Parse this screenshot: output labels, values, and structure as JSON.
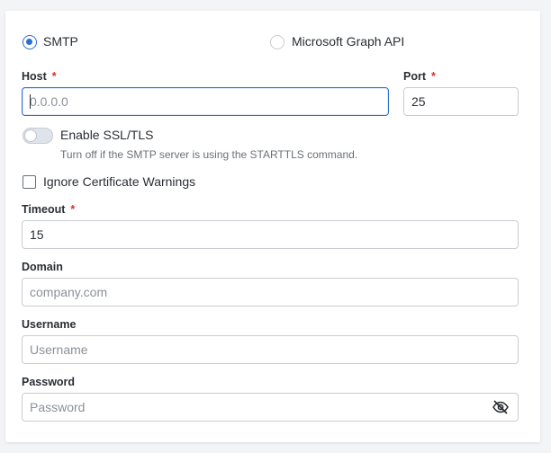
{
  "auth_method": {
    "options": [
      {
        "label": "SMTP",
        "selected": true
      },
      {
        "label": "Microsoft Graph API",
        "selected": false
      }
    ]
  },
  "host": {
    "label": "Host",
    "required_mark": "*",
    "placeholder": "0.0.0.0",
    "value": ""
  },
  "port": {
    "label": "Port",
    "required_mark": "*",
    "value": "25"
  },
  "ssl": {
    "label": "Enable SSL/TLS",
    "enabled": false,
    "help": "Turn off if the SMTP server is using the STARTTLS command."
  },
  "ignore_cert": {
    "label": "Ignore Certificate Warnings",
    "checked": false
  },
  "timeout": {
    "label": "Timeout",
    "required_mark": "*",
    "value": "15"
  },
  "domain": {
    "label": "Domain",
    "placeholder": "company.com",
    "value": ""
  },
  "username": {
    "label": "Username",
    "placeholder": "Username",
    "value": ""
  },
  "password": {
    "label": "Password",
    "placeholder": "Password",
    "value": "",
    "toggle_icon": "eye-slash-icon"
  },
  "colors": {
    "accent": "#2b6fd6",
    "required": "#d0342c",
    "border": "#c9ccd1"
  }
}
